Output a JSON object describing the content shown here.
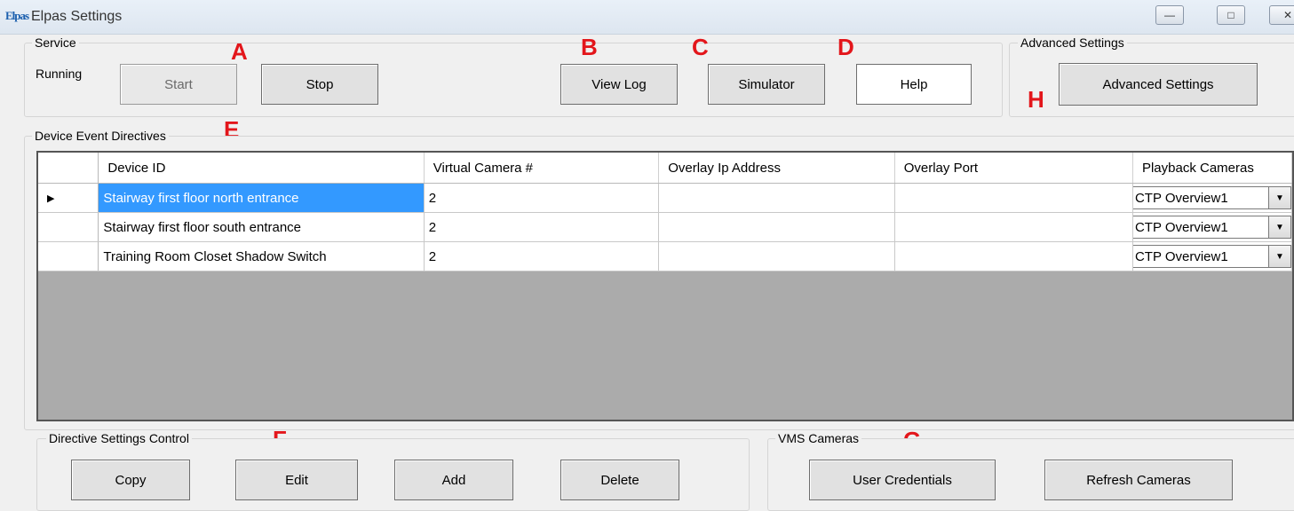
{
  "window": {
    "app_icon_text": "Elpas",
    "title": "Elpas Settings",
    "controls": [
      "—",
      "□",
      "✕"
    ]
  },
  "service": {
    "label": "Service",
    "status": "Running",
    "start_label": "Start",
    "stop_label": "Stop",
    "view_log_label": "View Log",
    "simulator_label": "Simulator",
    "help_label": "Help"
  },
  "advanced": {
    "label": "Advanced Settings",
    "button_label": "Advanced Settings"
  },
  "directives": {
    "label": "Device Event Directives",
    "columns": [
      "Device ID",
      "Virtual Camera #",
      "Overlay Ip Address",
      "Overlay Port",
      "Playback Cameras"
    ],
    "rows": [
      {
        "device_id": "Stairway first floor north entrance",
        "virtual_camera": "2",
        "overlay_ip": "",
        "overlay_port": "",
        "playback": "CTP Overview1"
      },
      {
        "device_id": "Stairway first floor south entrance",
        "virtual_camera": "2",
        "overlay_ip": "",
        "overlay_port": "",
        "playback": "CTP Overview1"
      },
      {
        "device_id": "Training Room Closet Shadow Switch",
        "virtual_camera": "2",
        "overlay_ip": "",
        "overlay_port": "",
        "playback": "CTP Overview1"
      }
    ],
    "current_row_marker": "▶"
  },
  "directive_control": {
    "label": "Directive Settings Control",
    "copy_label": "Copy",
    "edit_label": "Edit",
    "add_label": "Add",
    "delete_label": "Delete"
  },
  "vms": {
    "label": "VMS Cameras",
    "credentials_label": "User Credentials",
    "refresh_label": "Refresh Cameras"
  },
  "markers": {
    "a": "A",
    "b": "B",
    "c": "C",
    "d": "D",
    "e": "E",
    "f": "F",
    "g": "G",
    "h": "H"
  },
  "colors": {
    "marker": "#e3161b",
    "selection": "#3399ff",
    "grid_background": "#ababab"
  }
}
